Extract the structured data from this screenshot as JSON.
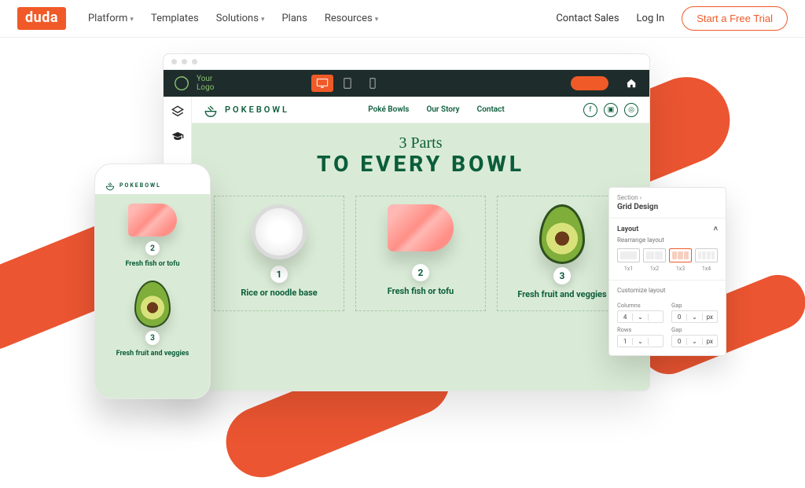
{
  "brand": "duda",
  "nav": {
    "items": [
      "Platform",
      "Templates",
      "Solutions",
      "Plans",
      "Resources"
    ],
    "has_dropdown": [
      true,
      false,
      true,
      false,
      true
    ],
    "contact": "Contact Sales",
    "login": "Log In",
    "cta": "Start a Free Trial"
  },
  "editor": {
    "yourlogo_line1": "Your",
    "yourlogo_line2": "Logo",
    "devices": [
      "desktop",
      "tablet",
      "mobile"
    ],
    "active_device": "desktop",
    "left_tools": [
      "layers-icon",
      "graduation-icon"
    ]
  },
  "site": {
    "brand": "POKEBOWL",
    "nav": [
      "Poké Bowls",
      "Our Story",
      "Contact"
    ],
    "socials": [
      "facebook",
      "youtube",
      "instagram"
    ],
    "hero_script": "3 Parts",
    "hero_big": "TO EVERY BOWL",
    "cards": [
      {
        "num": "1",
        "img": "rice",
        "caption": "Rice or noodle base"
      },
      {
        "num": "2",
        "img": "fish",
        "caption": "Fresh fish or tofu"
      },
      {
        "num": "3",
        "img": "avocado",
        "caption": "Fresh fruit and veggies"
      }
    ]
  },
  "phone": {
    "brand": "POKEBOWL",
    "items": [
      {
        "num": "2",
        "img": "fish",
        "caption": "Fresh fish or tofu"
      },
      {
        "num": "3",
        "img": "avocado",
        "caption": "Fresh fruit and veggies"
      }
    ]
  },
  "panel": {
    "crumb": "Section ›",
    "title": "Grid Design",
    "section": "Layout",
    "rearrange_label": "Rearrange layout",
    "layouts": [
      {
        "cols": 1,
        "label": "1x1"
      },
      {
        "cols": 2,
        "label": "1x2"
      },
      {
        "cols": 3,
        "label": "1x3",
        "selected": true
      },
      {
        "cols": 4,
        "label": "1x4"
      }
    ],
    "customize_label": "Customize layout",
    "controls": {
      "columns_label": "Columns",
      "columns": {
        "value": "4",
        "unit": ""
      },
      "columns_gap_label": "Gap",
      "columns_gap": {
        "value": "0",
        "unit": "px"
      },
      "rows_label": "Rows",
      "rows": {
        "value": "1",
        "unit": ""
      },
      "rows_gap_label": "Gap",
      "rows_gap": {
        "value": "0",
        "unit": "px"
      }
    }
  },
  "colors": {
    "accent": "#F05A28",
    "dark": "#1E2D2B",
    "mint": "#D9EBD6",
    "green": "#0B5D3B"
  }
}
